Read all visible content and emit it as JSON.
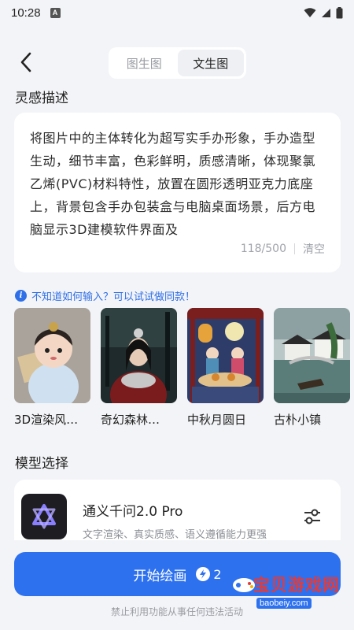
{
  "status": {
    "time": "10:28",
    "notif": "A"
  },
  "tabs": [
    {
      "label": "图生图",
      "active": false
    },
    {
      "label": "文生图",
      "active": true
    }
  ],
  "inspiration": {
    "title": "灵感描述",
    "prompt": "将图片中的主体转化为超写实手办形象，手办造型生动，细节丰富，色彩鲜明，质感清晰，体现聚氯乙烯(PVC)材料特性，放置在圆形透明亚克力底座上，背景包含手办包装盒与电脑桌面场景，后方电脑显示3D建模软件界面及",
    "counter": "118/500",
    "clear": "清空"
  },
  "hint": "不知道如何输入？可以试试做同款！",
  "examples": [
    {
      "label": "3D渲染风…",
      "icon": "cartoon-girl-thumbnail"
    },
    {
      "label": "奇幻森林…",
      "icon": "forest-woman-thumbnail"
    },
    {
      "label": "中秋月圆日",
      "icon": "mid-autumn-thumbnail"
    },
    {
      "label": "古朴小镇",
      "icon": "old-town-thumbnail"
    }
  ],
  "model": {
    "section_title": "模型选择",
    "name": "通义千问2.0 Pro",
    "desc": "文字渲染、真实质感、语义遵循能力更强"
  },
  "action": {
    "label": "开始绘画",
    "cost": "2"
  },
  "disclaimer": "禁止利用功能从事任何违法活动",
  "watermark": {
    "text": "宝贝游戏网",
    "url": "baobeiy.com"
  },
  "colors": {
    "accent": "#2d71ef",
    "background": "#f3f4f7",
    "card": "#ffffff"
  }
}
